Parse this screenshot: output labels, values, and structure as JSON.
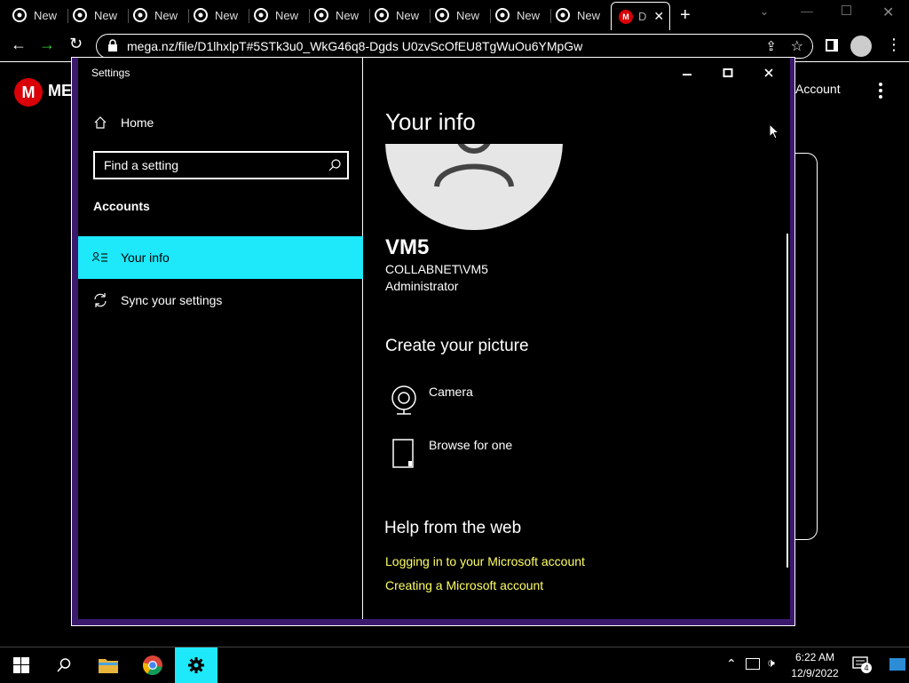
{
  "browser": {
    "tabs": [
      {
        "label": "New"
      },
      {
        "label": "New"
      },
      {
        "label": "New"
      },
      {
        "label": "New"
      },
      {
        "label": "New"
      },
      {
        "label": "New"
      },
      {
        "label": "New"
      },
      {
        "label": "New"
      },
      {
        "label": "New"
      },
      {
        "label": "New"
      }
    ],
    "active_tab": {
      "label": "D"
    },
    "url": "mega.nz/file/D1lhxlpT#5STk3u0_WkG46q8-Dgds U0zvScOfEU8TgWuOu6YMpGw"
  },
  "mega": {
    "logo_letter": "M",
    "brand_partial": "ME",
    "account_label": "Account"
  },
  "settings": {
    "window_title": "Settings",
    "home_label": "Home",
    "search_placeholder": "Find a setting",
    "section_heading": "Accounts",
    "nav": [
      {
        "label": "Your info",
        "icon": "contact-info-icon",
        "selected": true
      },
      {
        "label": "Sync your settings",
        "icon": "sync-icon",
        "selected": false
      }
    ],
    "page_title": "Your info",
    "user": {
      "name": "VM5",
      "domain_account": "COLLABNET\\VM5",
      "role": "Administrator"
    },
    "create_picture_heading": "Create your picture",
    "picture_options": [
      {
        "label": "Camera",
        "icon": "camera-icon"
      },
      {
        "label": "Browse for one",
        "icon": "browse-file-icon"
      }
    ],
    "help_heading": "Help from the web",
    "help_links": [
      "Logging in to your Microsoft account",
      "Creating a Microsoft account"
    ],
    "accent_color": "#1de9fb",
    "link_color": "#ffff66"
  },
  "taskbar": {
    "time": "6:22 AM",
    "date": "12/9/2022",
    "notification_count": "4"
  }
}
